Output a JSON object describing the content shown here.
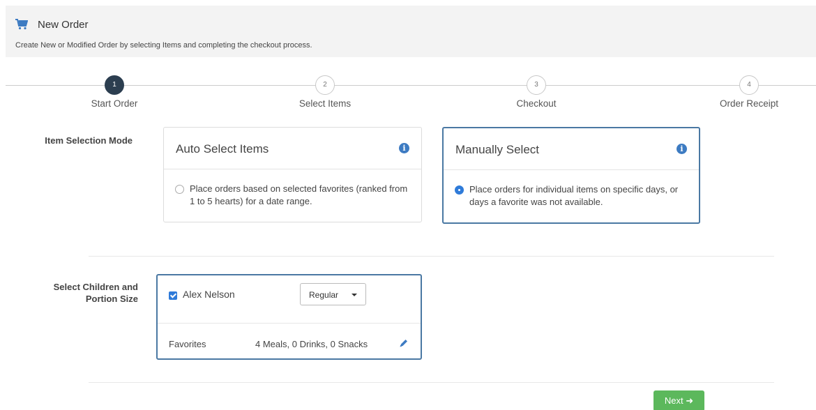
{
  "header": {
    "icon": "shopping-cart-icon",
    "title": "New Order",
    "subtitle": "Create New or Modified Order by selecting Items and completing the checkout process."
  },
  "steps": [
    {
      "number": "1",
      "label": "Start Order",
      "active": true
    },
    {
      "number": "2",
      "label": "Select Items",
      "active": false
    },
    {
      "number": "3",
      "label": "Checkout",
      "active": false
    },
    {
      "number": "4",
      "label": "Order Receipt",
      "active": false
    }
  ],
  "item_selection": {
    "label": "Item Selection Mode",
    "auto": {
      "title": "Auto Select Items",
      "info_icon": "info-circle-icon",
      "description": "Place orders based on selected favorites (ranked from 1 to 5 hearts) for a date range.",
      "selected": false
    },
    "manual": {
      "title": "Manually Select",
      "info_icon": "info-circle-icon",
      "description": "Place orders for individual items on specific days, or days a favorite was not available.",
      "selected": true
    }
  },
  "children": {
    "label_line1": "Select Children and",
    "label_line2": "Portion Size",
    "child": {
      "name": "Alex Nelson",
      "checked": true,
      "portion": "Regular",
      "favorites_label": "Favorites",
      "favorites_counts": "4 Meals,  0 Drinks,  0 Snacks",
      "edit_icon": "pencil-icon"
    }
  },
  "actions": {
    "next_label": "Next"
  },
  "colors": {
    "accent": "#4a78a3",
    "radio": "#2f7bd9",
    "active_step": "#2c3e50",
    "next_button": "#5cb85c"
  }
}
